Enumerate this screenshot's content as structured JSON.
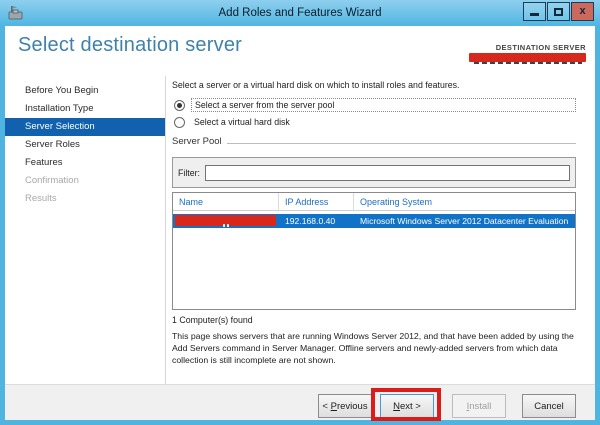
{
  "window": {
    "title": "Add Roles and Features Wizard"
  },
  "header": {
    "title": "Select destination server",
    "context_label": "DESTINATION SERVER",
    "server_name_redacted": true
  },
  "sidebar": {
    "items": [
      {
        "label": "Before You Begin",
        "state": "normal"
      },
      {
        "label": "Installation Type",
        "state": "normal"
      },
      {
        "label": "Server Selection",
        "state": "selected"
      },
      {
        "label": "Server Roles",
        "state": "normal"
      },
      {
        "label": "Features",
        "state": "normal"
      },
      {
        "label": "Confirmation",
        "state": "disabled"
      },
      {
        "label": "Results",
        "state": "disabled"
      }
    ]
  },
  "main": {
    "intro": "Select a server or a virtual hard disk on which to install roles and features.",
    "radio_server_pool": {
      "label": "Select a server from the server pool",
      "selected": true
    },
    "radio_vhd": {
      "label": "Select a virtual hard disk",
      "selected": false
    },
    "server_pool": {
      "section_label": "Server Pool",
      "filter_label": "Filter:",
      "filter_value": "",
      "columns": [
        "Name",
        "IP Address",
        "Operating System"
      ],
      "rows": [
        {
          "name_redacted": true,
          "ip": "192.168.0.40",
          "os": "Microsoft Windows Server 2012 Datacenter Evaluation",
          "selected": true
        }
      ],
      "found_text": "1 Computer(s) found"
    },
    "description": "This page shows servers that are running Windows Server 2012, and that have been added by using the Add Servers command in Server Manager. Offline servers and newly-added servers from which data collection is still incomplete are not shown."
  },
  "footer": {
    "previous": {
      "prefix": "< ",
      "key": "P",
      "rest": "revious"
    },
    "next": {
      "prefix": "",
      "key": "N",
      "rest": "ext >"
    },
    "install": {
      "prefix": "",
      "key": "I",
      "rest": "nstall"
    },
    "cancel": {
      "prefix": "",
      "key": "",
      "rest": "Cancel"
    }
  },
  "colors": {
    "titlebar_blue": "#4fb6e2",
    "sidebar_selected": "#1261ae",
    "row_selected": "#1173c8",
    "column_header_blue": "#1b6ec2",
    "page_title_blue": "#3e82ab",
    "close_button_red": "#cd685c",
    "annotation_red": "#dc1b1b",
    "redaction_red": "#d8281c"
  }
}
